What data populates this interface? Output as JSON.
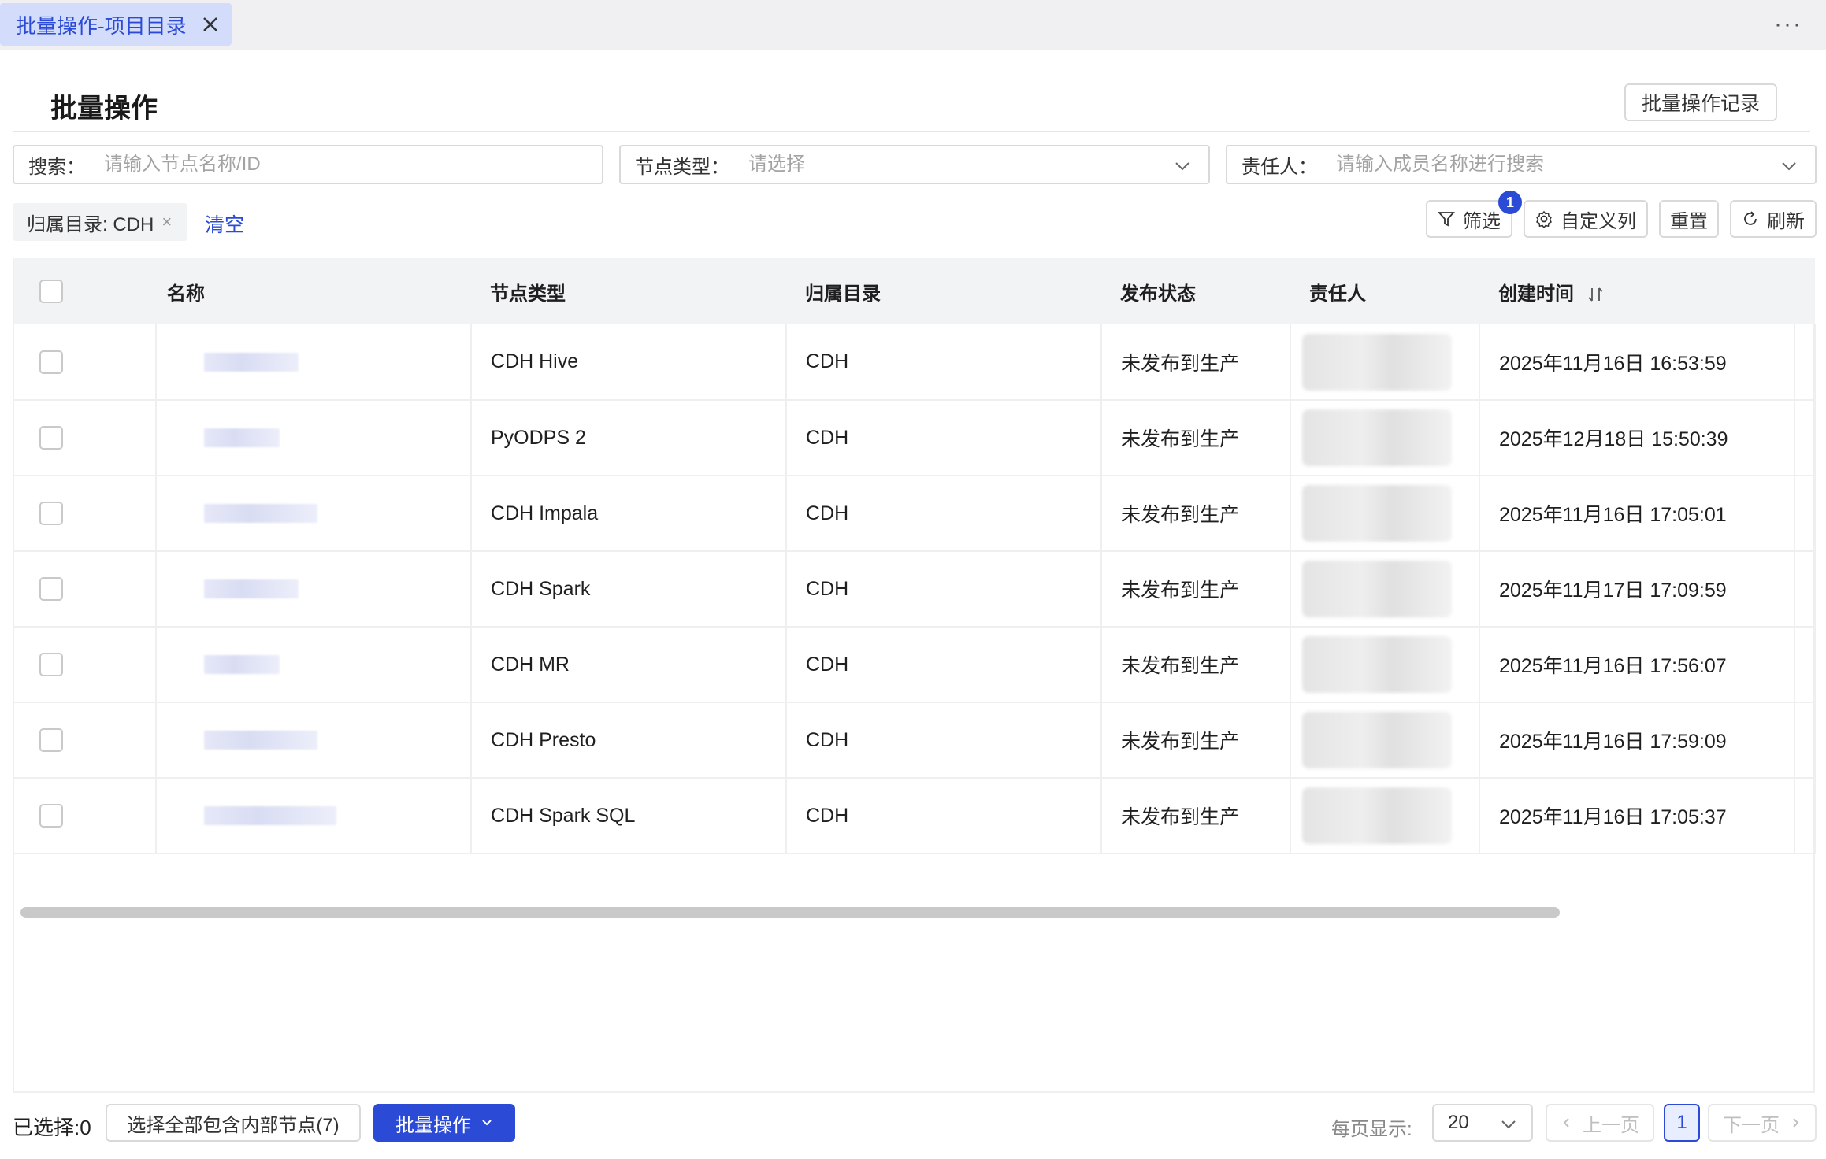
{
  "tab": {
    "label": "批量操作-项目目录"
  },
  "page": {
    "title": "批量操作",
    "history_button": "批量操作记录"
  },
  "filters": {
    "search": {
      "label": "搜索：",
      "placeholder": "请输入节点名称/ID"
    },
    "node_type": {
      "label": "节点类型：",
      "placeholder": "请选择"
    },
    "owner": {
      "label": "责任人：",
      "placeholder": "请输入成员名称进行搜索"
    }
  },
  "active_tag": {
    "label": "归属目录: CDH",
    "close": "×"
  },
  "clear_label": "清空",
  "toolbar": {
    "filter_label": "筛选",
    "filter_badge": "1",
    "custom_columns_label": "自定义列",
    "reset_label": "重置",
    "refresh_label": "刷新"
  },
  "table": {
    "headers": {
      "name": "名称",
      "node_type": "节点类型",
      "directory": "归属目录",
      "status": "发布状态",
      "owner": "责任人",
      "created": "创建时间"
    },
    "rows": [
      {
        "node_type": "CDH Hive",
        "directory": "CDH",
        "status": "未发布到生产",
        "created": "2025年11月16日 16:53:59"
      },
      {
        "node_type": "PyODPS 2",
        "directory": "CDH",
        "status": "未发布到生产",
        "created": "2025年12月18日 15:50:39"
      },
      {
        "node_type": "CDH Impala",
        "directory": "CDH",
        "status": "未发布到生产",
        "created": "2025年11月16日 17:05:01"
      },
      {
        "node_type": "CDH Spark",
        "directory": "CDH",
        "status": "未发布到生产",
        "created": "2025年11月17日 17:09:59"
      },
      {
        "node_type": "CDH MR",
        "directory": "CDH",
        "status": "未发布到生产",
        "created": "2025年11月16日 17:56:07"
      },
      {
        "node_type": "CDH Presto",
        "directory": "CDH",
        "status": "未发布到生产",
        "created": "2025年11月16日 17:59:09"
      },
      {
        "node_type": "CDH Spark SQL",
        "directory": "CDH",
        "status": "未发布到生产",
        "created": "2025年11月16日 17:05:37"
      }
    ]
  },
  "footer": {
    "selected": "已选择:0",
    "select_all_button": "选择全部包含内部节点(7)",
    "batch_button": "批量操作",
    "per_page_label": "每页显示:",
    "page_size": "20",
    "prev_label": "上一页",
    "current_page": "1",
    "next_label": "下一页"
  },
  "colors": {
    "accent": "#2b4bd6",
    "tab_bg": "#d4dcfb",
    "header_bg": "#f2f3f5"
  },
  "icons": [
    "close-icon",
    "more-icon",
    "chevron-down-icon",
    "filter-icon",
    "gear-icon",
    "refresh-icon",
    "sort-icon",
    "chevron-left-icon",
    "chevron-right-icon"
  ]
}
